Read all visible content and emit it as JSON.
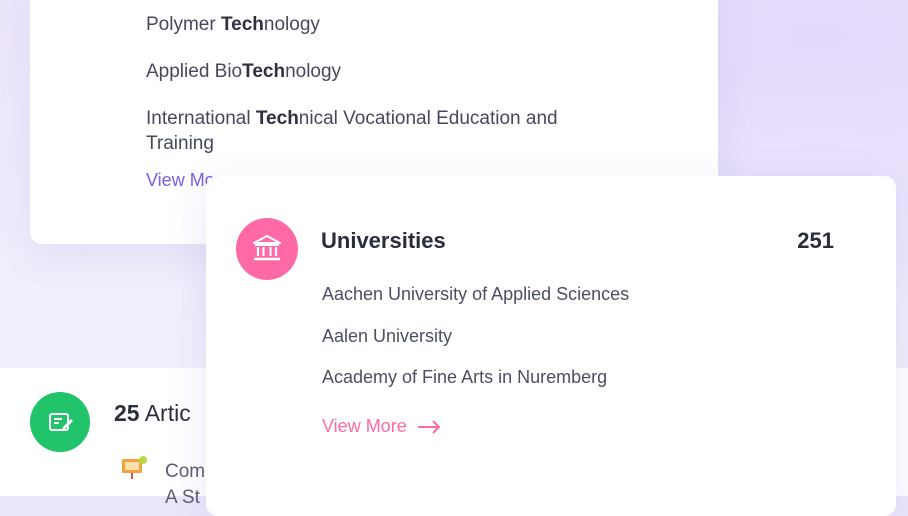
{
  "programs_card": {
    "items": [
      {
        "before": "Polymer ",
        "bold": "Tech",
        "after": "nology"
      },
      {
        "before": "Applied Bio",
        "bold": "Tech",
        "after": "nology"
      },
      {
        "before": "International ",
        "bold": "Tech",
        "after": "nical Vocational Education and Training"
      }
    ],
    "view_more": "View More"
  },
  "universities_card": {
    "title": "Universities",
    "count": "251",
    "items": [
      "Aachen University of Applied Sciences",
      "Aalen University",
      "Academy of Fine Arts in Nuremberg"
    ],
    "view_more": "View More",
    "icon": "bank-icon",
    "accent": "#ff6aa6"
  },
  "articles_section": {
    "count": "25",
    "label": "Artic",
    "first_item": "Com\nA St",
    "icon": "edit-note-icon",
    "accent": "#21c46b"
  },
  "colors": {
    "programs_accent": "#7b5ce8",
    "text": "#454a5b"
  }
}
